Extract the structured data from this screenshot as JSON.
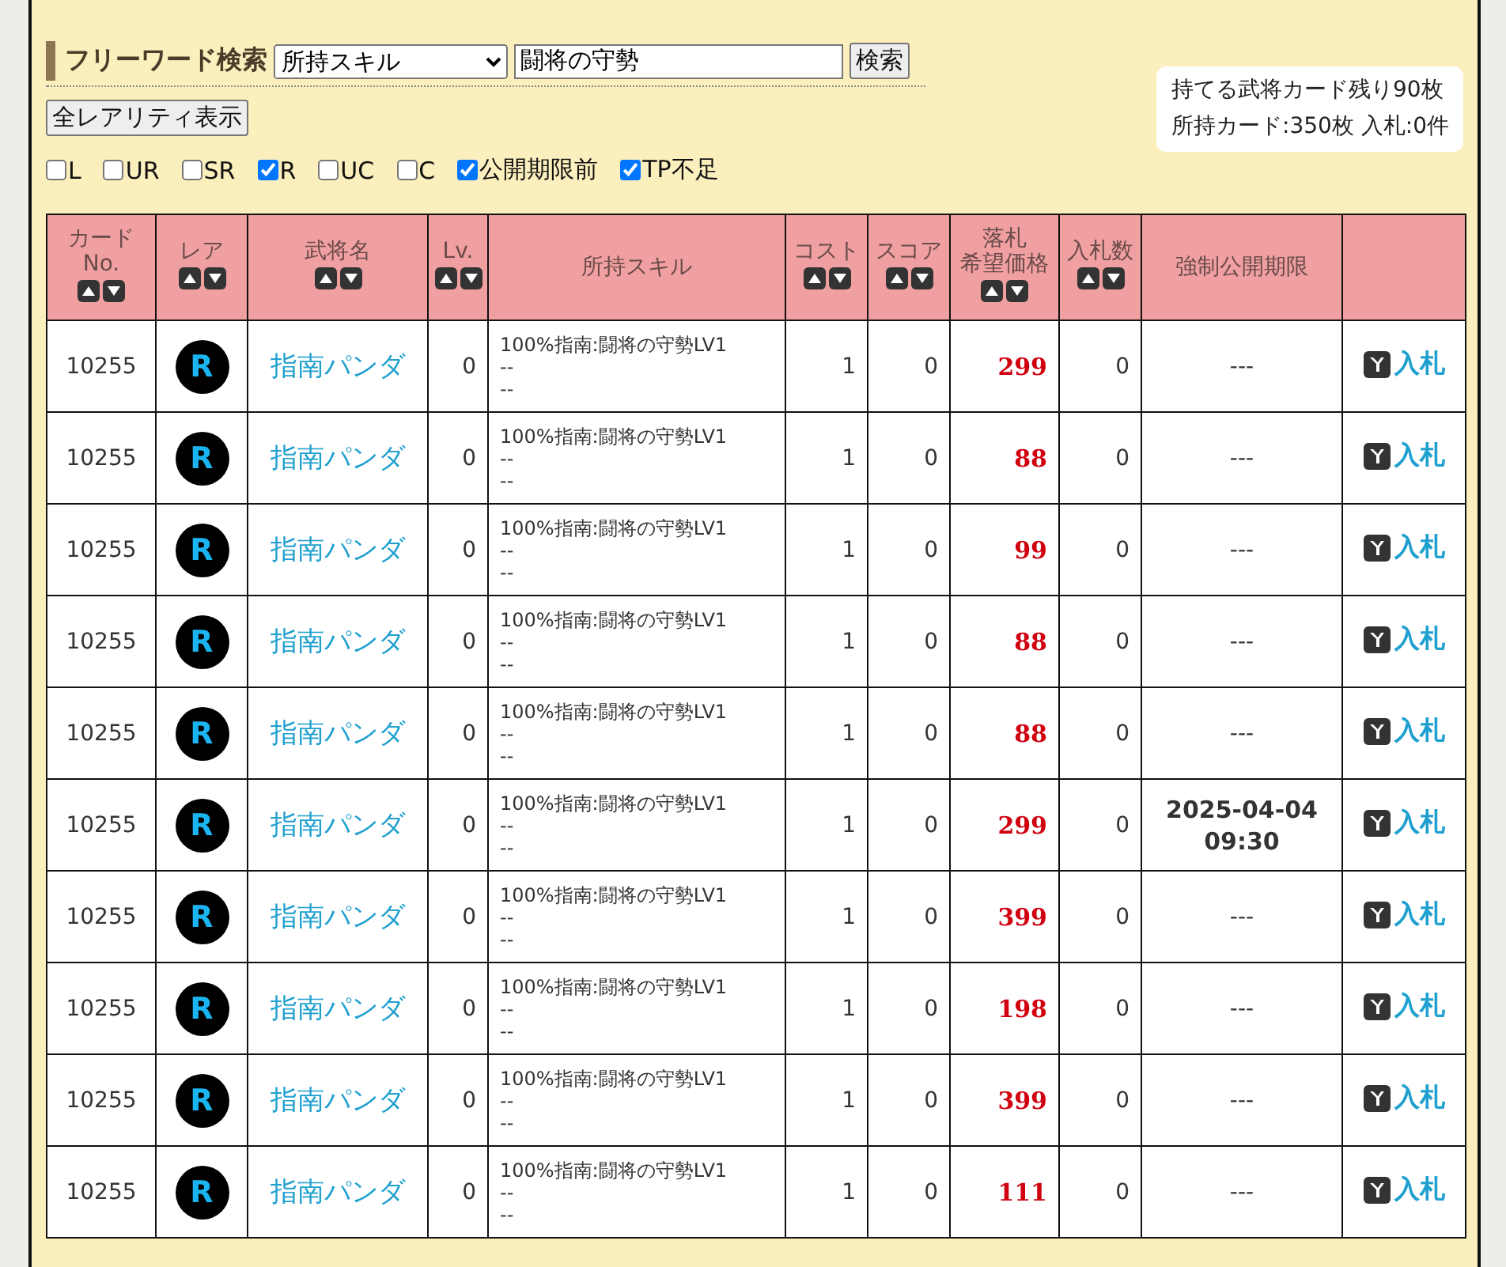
{
  "search": {
    "title": "フリーワード検索",
    "field_select": "所持スキル",
    "query": "闘将の守勢",
    "button": "検索"
  },
  "show_all_button": "全レアリティ表示",
  "filters": [
    {
      "label": "L",
      "checked": false
    },
    {
      "label": "UR",
      "checked": false
    },
    {
      "label": "SR",
      "checked": false
    },
    {
      "label": "R",
      "checked": true
    },
    {
      "label": "UC",
      "checked": false
    },
    {
      "label": "C",
      "checked": false
    },
    {
      "label": "公開期限前",
      "checked": true
    },
    {
      "label": "TP不足",
      "checked": true
    }
  ],
  "info": [
    "持てる武将カード残り90枚",
    "所持カード:350枚 入札:0件"
  ],
  "table": {
    "columns": [
      {
        "label": [
          "カード",
          "No."
        ],
        "sortable": true
      },
      {
        "label": [
          "レア"
        ],
        "sortable": true
      },
      {
        "label": [
          "武将名"
        ],
        "sortable": true
      },
      {
        "label": [
          "Lv."
        ],
        "sortable": true
      },
      {
        "label": [
          "所持スキル"
        ],
        "sortable": false
      },
      {
        "label": [
          "コスト"
        ],
        "sortable": true
      },
      {
        "label": [
          "スコア"
        ],
        "sortable": true
      },
      {
        "label": [
          "落札",
          "希望価格"
        ],
        "sortable": true
      },
      {
        "label": [
          "入札数"
        ],
        "sortable": true
      },
      {
        "label": [
          "強制公開期限"
        ],
        "sortable": false
      }
    ],
    "rows": [
      {
        "no": "10255",
        "rarity": "R",
        "name": "指南パンダ",
        "lv": "0",
        "skills": [
          "100%指南:闘将の守勢LV1",
          "--",
          "--"
        ],
        "cost": "1",
        "score": "0",
        "price": "299",
        "bids": "0",
        "deadline": {
          "set": false,
          "lines": [
            "---"
          ]
        },
        "action": "入札"
      },
      {
        "no": "10255",
        "rarity": "R",
        "name": "指南パンダ",
        "lv": "0",
        "skills": [
          "100%指南:闘将の守勢LV1",
          "--",
          "--"
        ],
        "cost": "1",
        "score": "0",
        "price": "88",
        "bids": "0",
        "deadline": {
          "set": false,
          "lines": [
            "---"
          ]
        },
        "action": "入札"
      },
      {
        "no": "10255",
        "rarity": "R",
        "name": "指南パンダ",
        "lv": "0",
        "skills": [
          "100%指南:闘将の守勢LV1",
          "--",
          "--"
        ],
        "cost": "1",
        "score": "0",
        "price": "99",
        "bids": "0",
        "deadline": {
          "set": false,
          "lines": [
            "---"
          ]
        },
        "action": "入札"
      },
      {
        "no": "10255",
        "rarity": "R",
        "name": "指南パンダ",
        "lv": "0",
        "skills": [
          "100%指南:闘将の守勢LV1",
          "--",
          "--"
        ],
        "cost": "1",
        "score": "0",
        "price": "88",
        "bids": "0",
        "deadline": {
          "set": false,
          "lines": [
            "---"
          ]
        },
        "action": "入札"
      },
      {
        "no": "10255",
        "rarity": "R",
        "name": "指南パンダ",
        "lv": "0",
        "skills": [
          "100%指南:闘将の守勢LV1",
          "--",
          "--"
        ],
        "cost": "1",
        "score": "0",
        "price": "88",
        "bids": "0",
        "deadline": {
          "set": false,
          "lines": [
            "---"
          ]
        },
        "action": "入札"
      },
      {
        "no": "10255",
        "rarity": "R",
        "name": "指南パンダ",
        "lv": "0",
        "skills": [
          "100%指南:闘将の守勢LV1",
          "--",
          "--"
        ],
        "cost": "1",
        "score": "0",
        "price": "299",
        "bids": "0",
        "deadline": {
          "set": true,
          "lines": [
            "2025-04-04",
            "09:30"
          ]
        },
        "action": "入札"
      },
      {
        "no": "10255",
        "rarity": "R",
        "name": "指南パンダ",
        "lv": "0",
        "skills": [
          "100%指南:闘将の守勢LV1",
          "--",
          "--"
        ],
        "cost": "1",
        "score": "0",
        "price": "399",
        "bids": "0",
        "deadline": {
          "set": false,
          "lines": [
            "---"
          ]
        },
        "action": "入札"
      },
      {
        "no": "10255",
        "rarity": "R",
        "name": "指南パンダ",
        "lv": "0",
        "skills": [
          "100%指南:闘将の守勢LV1",
          "--",
          "--"
        ],
        "cost": "1",
        "score": "0",
        "price": "198",
        "bids": "0",
        "deadline": {
          "set": false,
          "lines": [
            "---"
          ]
        },
        "action": "入札"
      },
      {
        "no": "10255",
        "rarity": "R",
        "name": "指南パンダ",
        "lv": "0",
        "skills": [
          "100%指南:闘将の守勢LV1",
          "--",
          "--"
        ],
        "cost": "1",
        "score": "0",
        "price": "399",
        "bids": "0",
        "deadline": {
          "set": false,
          "lines": [
            "---"
          ]
        },
        "action": "入札"
      },
      {
        "no": "10255",
        "rarity": "R",
        "name": "指南パンダ",
        "lv": "0",
        "skills": [
          "100%指南:闘将の守勢LV1",
          "--",
          "--"
        ],
        "cost": "1",
        "score": "0",
        "price": "111",
        "bids": "0",
        "deadline": {
          "set": false,
          "lines": [
            "---"
          ]
        },
        "action": "入札"
      }
    ]
  }
}
